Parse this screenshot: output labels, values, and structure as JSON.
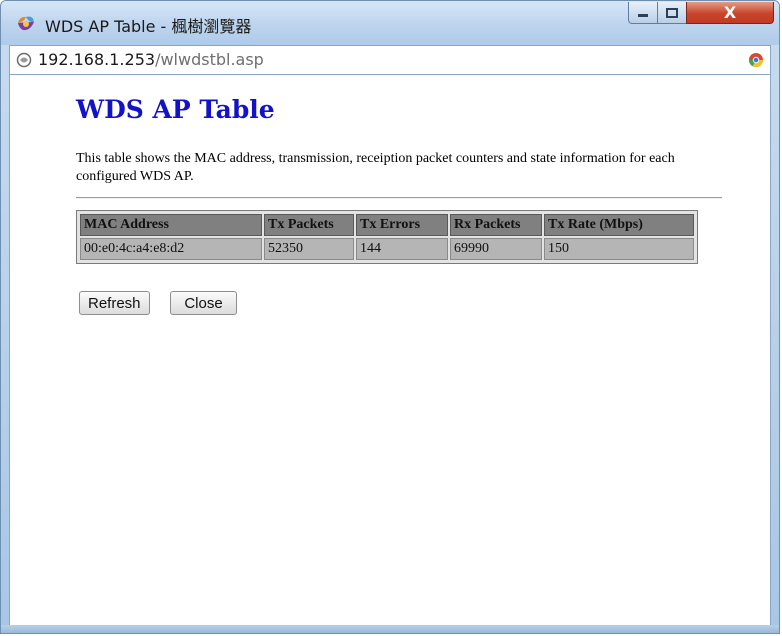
{
  "window": {
    "title": "WDS AP Table - 楓樹瀏覽器",
    "icon": "maple-browser-icon",
    "controls": {
      "minimize_icon": "minimize-icon",
      "maximize_icon": "maximize-icon",
      "close_label": "X"
    }
  },
  "addressbar": {
    "host": "192.168.1.253",
    "path": "/wlwdstbl.asp",
    "page_icon": "page-icon",
    "browser_icon": "chrome-icon"
  },
  "page": {
    "title": "WDS AP Table",
    "title_color": "#1212c8",
    "description": "This table shows the MAC address, transmission, receiption packet counters and state information for each configured WDS AP.",
    "table": {
      "headers": [
        "MAC Address",
        "Tx Packets",
        "Tx Errors",
        "Rx Packets",
        "Tx Rate (Mbps)"
      ],
      "rows": [
        [
          "00:e0:4c:a4:e8:d2",
          "52350",
          "144",
          "69990",
          "150"
        ]
      ]
    },
    "buttons": {
      "refresh": "Refresh",
      "close": "Close"
    }
  }
}
